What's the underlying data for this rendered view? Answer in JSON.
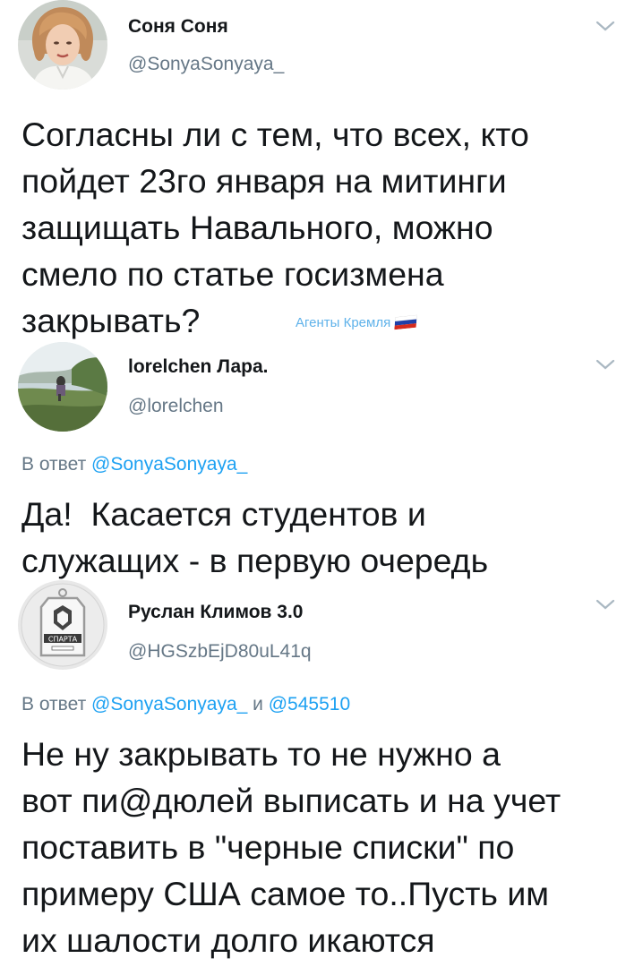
{
  "tweets": [
    {
      "display_name": "Соня Соня",
      "handle": "@SonyaSonyaya_",
      "avatar": "woman-portrait-avatar",
      "menu_icon": "chevron-down-icon",
      "lines": [
        "Согласны ли с тем, что всех, кто",
        "пойдет 23го января на митинги",
        "защищать Навального, можно",
        "смело по статье госизмена",
        "закрывать?"
      ]
    },
    {
      "display_name": "lorelchen Лара.",
      "handle": "@lorelchen",
      "avatar": "landscape-photo-avatar",
      "menu_icon": "chevron-down-icon",
      "reply_prefix": "В ответ",
      "reply_mentions": [
        "@SonyaSonyaya_"
      ],
      "lines": [
        "Да!  Касается студентов и",
        "служащих - в первую очередь"
      ]
    },
    {
      "display_name": "Руслан Климов 3.0",
      "handle": "@HGSzbEjD80uL41q",
      "avatar": "spartak-tag-avatar",
      "avatar_tag_text": "СПАРТА",
      "menu_icon": "chevron-down-icon",
      "reply_prefix": "В ответ",
      "reply_joiner": "и",
      "reply_mentions": [
        "@SonyaSonyaya_",
        "@545510"
      ],
      "lines": [
        "Не ну закрывать то не нужно а",
        "вот пи@дюлей выписать и на учет",
        "поставить в \"черные списки\" по",
        "примеру США самое то..Пусть им",
        "их шалости долго икаются"
      ]
    }
  ],
  "watermark": {
    "text": "Агенты Кремля",
    "icon": "russian-flag-icon"
  },
  "colors": {
    "text": "#14171a",
    "secondary": "#657786",
    "mention": "#1da1f2",
    "watermark": "#5fb2ea"
  }
}
